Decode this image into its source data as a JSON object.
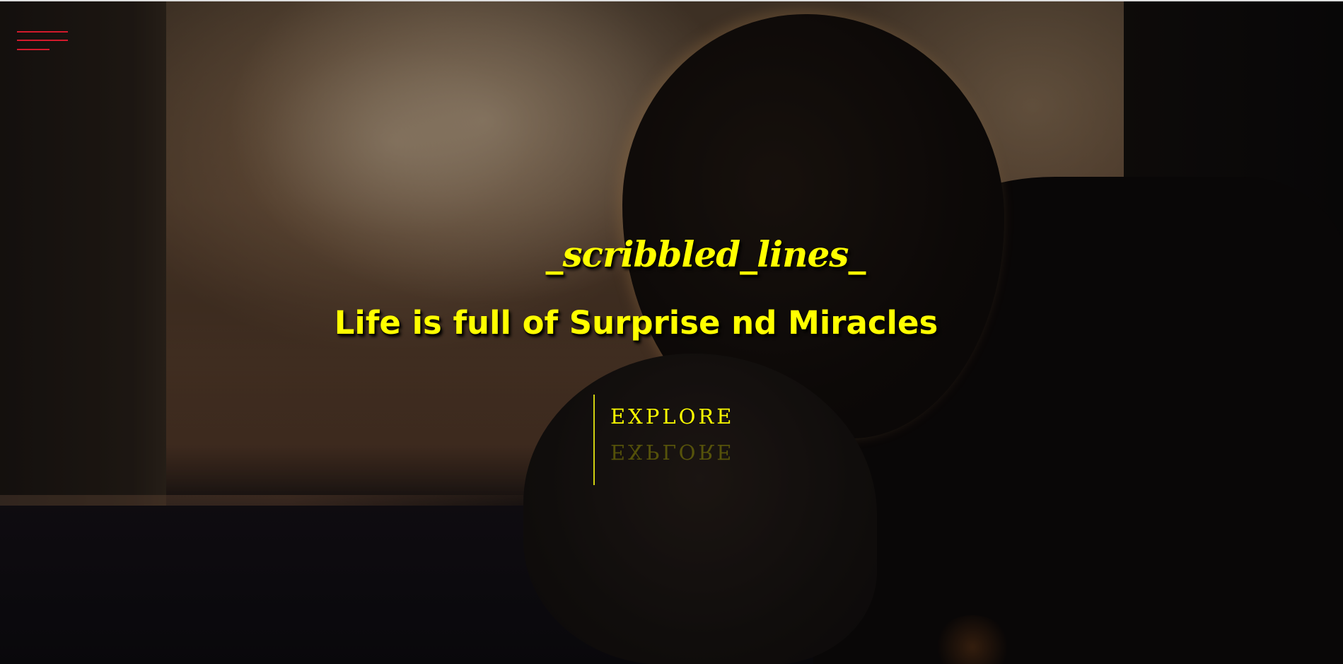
{
  "brand": {
    "title": "_scribbled_lines_"
  },
  "hero": {
    "tagline": "Life is full of Surprise nd Miracles",
    "explore_label": "EXPLORE",
    "explore_reflection": "EXPLORE"
  },
  "menu": {
    "icon": "hamburger-menu-icon",
    "color": "#d21a2c"
  },
  "colors": {
    "accent": "#ffff00"
  }
}
